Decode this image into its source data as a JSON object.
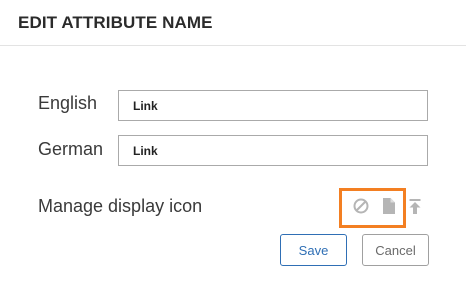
{
  "dialog": {
    "title": "EDIT ATTRIBUTE NAME"
  },
  "fields": [
    {
      "label": "English",
      "value": "Link"
    },
    {
      "label": "German",
      "value": "Link"
    }
  ],
  "manage_icon": {
    "label": "Manage display icon",
    "icons": [
      "no-icon",
      "file-icon",
      "upload-icon"
    ]
  },
  "buttons": {
    "save_label": "Save",
    "cancel_label": "Cancel"
  },
  "colors": {
    "highlight_border": "#f37f22",
    "primary": "#2f6fb5",
    "icon_gray": "#b5b5b5"
  }
}
